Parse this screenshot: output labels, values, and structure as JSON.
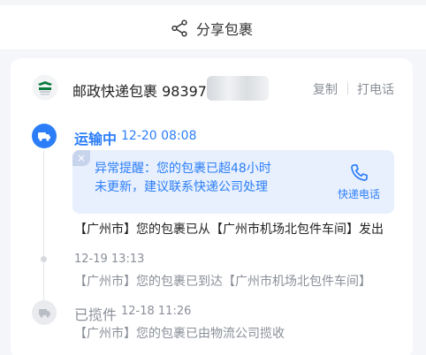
{
  "share": {
    "label": "分享包裹"
  },
  "package": {
    "title": "邮政快递包裹 98397",
    "copy_label": "复制",
    "call_label": "打电话"
  },
  "status": {
    "label": "运输中",
    "time": "12-20 08:08",
    "color": "#2c7ef8"
  },
  "alert": {
    "close": "×",
    "line1": "异常提醒：您的包裹已超48小时",
    "line2": "未更新，建议联系快递公司处理",
    "phone_label": "快递电话",
    "bg": "#e8f0fd"
  },
  "events": [
    {
      "text": "【广州市】您的包裹已从【广州市机场北包件车间】发出"
    },
    {
      "time": "12-19 13:13",
      "text": "【广州市】您的包裹已到达【广州市机场北包件车间】"
    },
    {
      "label": "已揽件",
      "time": "12-18 11:26",
      "text": "【广州市】您的包裹已由物流公司揽收"
    }
  ],
  "icons": {
    "share": "share-icon",
    "truck": "truck-icon",
    "phone": "phone-icon",
    "box": "box-icon",
    "logo": "china-post-logo"
  }
}
